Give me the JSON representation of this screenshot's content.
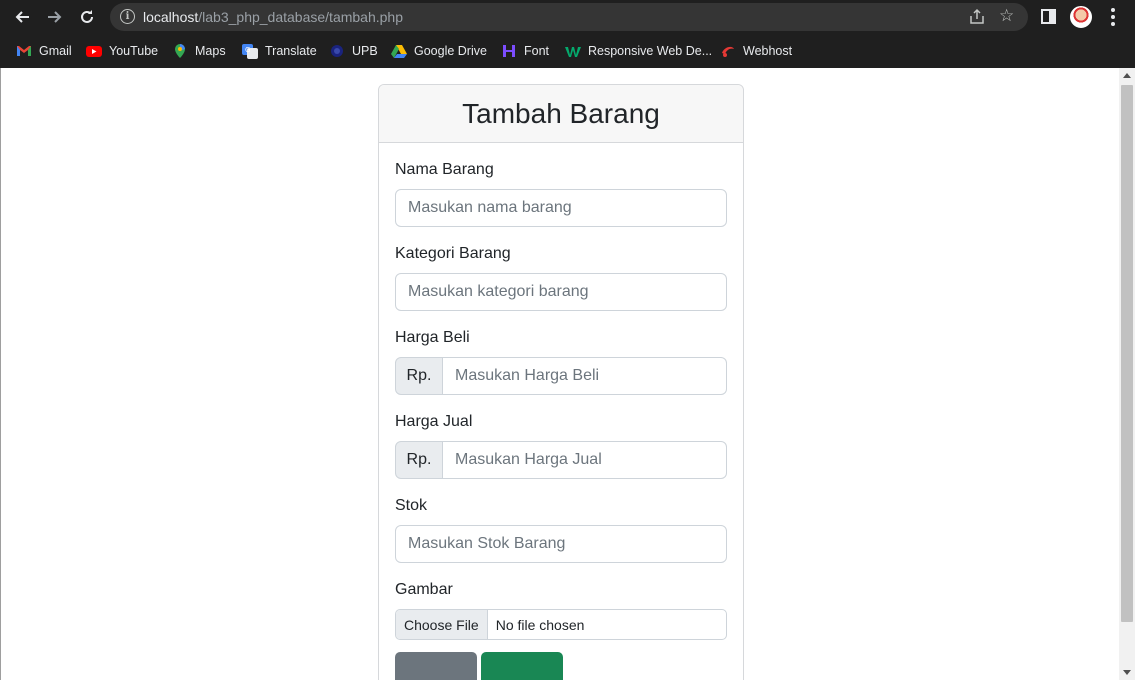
{
  "browser": {
    "url_host": "localhost",
    "url_path": "/lab3_php_database/tambah.php",
    "bookmarks": [
      {
        "label": "Gmail",
        "icon": "gmail-icon"
      },
      {
        "label": "YouTube",
        "icon": "youtube-icon"
      },
      {
        "label": "Maps",
        "icon": "maps-icon"
      },
      {
        "label": "Translate",
        "icon": "translate-icon"
      },
      {
        "label": "UPB",
        "icon": "upb-icon"
      },
      {
        "label": "Google Drive",
        "icon": "google-drive-icon"
      },
      {
        "label": "Font",
        "icon": "font-icon"
      },
      {
        "label": "Responsive Web De...",
        "icon": "w3-icon"
      },
      {
        "label": "Webhost",
        "icon": "webhost-icon"
      }
    ]
  },
  "form": {
    "title": "Tambah Barang",
    "fields": [
      {
        "label": "Nama Barang",
        "placeholder": "Masukan nama barang"
      },
      {
        "label": "Kategori Barang",
        "placeholder": "Masukan kategori barang"
      },
      {
        "label": "Harga Beli",
        "prefix": "Rp.",
        "placeholder": "Masukan Harga Beli"
      },
      {
        "label": "Harga Jual",
        "prefix": "Rp.",
        "placeholder": "Masukan Harga Jual"
      },
      {
        "label": "Stok",
        "placeholder": "Masukan Stok Barang"
      },
      {
        "label": "Gambar",
        "file_button": "Choose File",
        "file_status": "No file chosen"
      }
    ]
  },
  "colors": {
    "chrome_bg": "#1f1f1f",
    "button_secondary": "#6c757d",
    "button_success": "#198754"
  }
}
